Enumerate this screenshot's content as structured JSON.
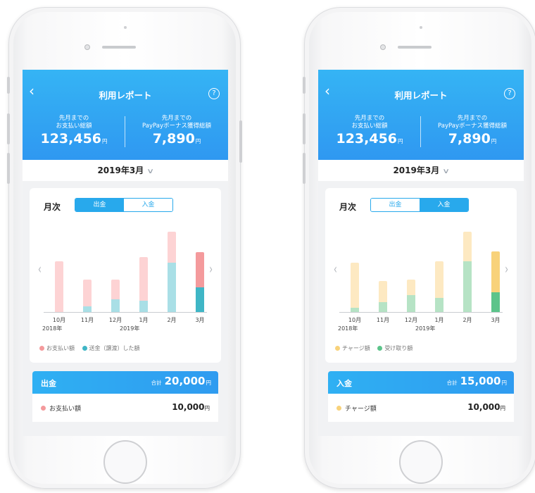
{
  "screens": [
    {
      "header": {
        "back_icon": "chevron-left-icon",
        "title": "利用レポート",
        "help_icon": "question-circle-icon",
        "left_label": "先月までの\nお支払い総額",
        "left_value": "123,456",
        "right_label": "先月までの\nPayPayボーナス獲得総額",
        "right_value": "7,890",
        "yen": "円"
      },
      "month_selector": {
        "label": "2019年3月",
        "icon": "chevron-down-icon"
      },
      "chart_card": {
        "mode_label": "月次",
        "tabs": [
          {
            "label": "出金",
            "active": true
          },
          {
            "label": "入金",
            "active": false
          }
        ],
        "legend": [
          {
            "label": "お支払い額",
            "color": "#f49a9c"
          },
          {
            "label": "送金（譲渡）した額",
            "color": "#3fb6c6"
          }
        ]
      },
      "chart_data": {
        "type": "bar",
        "stacked": true,
        "categories": [
          "10月",
          "11月",
          "12月",
          "1月",
          "2月",
          "3月"
        ],
        "year_labels": [
          "2018年",
          "2019年"
        ],
        "series": [
          {
            "name": "お支払い額",
            "values": [
              72,
              38,
              28,
              62,
              44,
              50
            ],
            "colors": [
              "#fdd3d4",
              "#fdd3d4",
              "#fdd3d4",
              "#fdd3d4",
              "#fdd3d4",
              "#f49a9c"
            ]
          },
          {
            "name": "送金（譲渡）した額",
            "values": [
              0,
              8,
              18,
              16,
              70,
              35
            ],
            "colors": [
              "#a9dfe6",
              "#a9dfe6",
              "#a9dfe6",
              "#a9dfe6",
              "#a9dfe6",
              "#3fb6c6"
            ]
          }
        ],
        "ylim": [
          0,
          120
        ]
      },
      "summary": {
        "kind": "出金",
        "total_label": "合計",
        "total": "20,000",
        "yen": "円",
        "rows": [
          {
            "label": "お支払い額",
            "amount": "10,000",
            "color": "#f49a9c"
          }
        ]
      }
    },
    {
      "header": {
        "back_icon": "chevron-left-icon",
        "title": "利用レポート",
        "help_icon": "question-circle-icon",
        "left_label": "先月までの\nお支払い総額",
        "left_value": "123,456",
        "right_label": "先月までの\nPayPayボーナス獲得総額",
        "right_value": "7,890",
        "yen": "円"
      },
      "month_selector": {
        "label": "2019年3月",
        "icon": "chevron-down-icon"
      },
      "chart_card": {
        "mode_label": "月次",
        "tabs": [
          {
            "label": "出金",
            "active": false
          },
          {
            "label": "入金",
            "active": true
          }
        ],
        "legend": [
          {
            "label": "チャージ額",
            "color": "#f8d27a"
          },
          {
            "label": "受け取り額",
            "color": "#5cc48a"
          }
        ]
      },
      "chart_data": {
        "type": "bar",
        "stacked": true,
        "categories": [
          "10月",
          "11月",
          "12月",
          "1月",
          "2月",
          "3月"
        ],
        "year_labels": [
          "2018年",
          "2019年"
        ],
        "series": [
          {
            "name": "チャージ額",
            "values": [
              64,
              30,
              22,
              52,
              42,
              58
            ],
            "colors": [
              "#fde9c2",
              "#fde9c2",
              "#fde9c2",
              "#fde9c2",
              "#fde9c2",
              "#f8d27a"
            ]
          },
          {
            "name": "受け取り額",
            "values": [
              6,
              14,
              24,
              20,
              72,
              28
            ],
            "colors": [
              "#b6e3c5",
              "#b6e3c5",
              "#b6e3c5",
              "#b6e3c5",
              "#b6e3c5",
              "#5cc48a"
            ]
          }
        ],
        "ylim": [
          0,
          120
        ]
      },
      "summary": {
        "kind": "入金",
        "total_label": "合計",
        "total": "15,000",
        "yen": "円",
        "rows": [
          {
            "label": "チャージ額",
            "amount": "10,000",
            "color": "#f8d27a"
          }
        ]
      }
    }
  ]
}
